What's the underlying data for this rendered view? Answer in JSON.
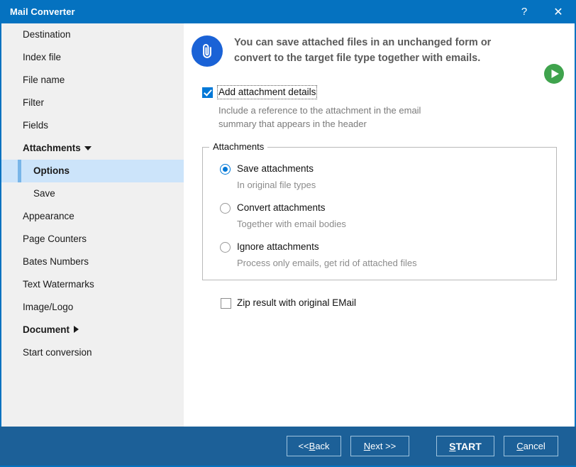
{
  "window": {
    "title": "Mail Converter",
    "help_label": "?",
    "close_label": "✕"
  },
  "sidebar": {
    "items": [
      {
        "label": "Destination",
        "kind": "item"
      },
      {
        "label": "Index file",
        "kind": "item"
      },
      {
        "label": "File name",
        "kind": "item"
      },
      {
        "label": "Filter",
        "kind": "item"
      },
      {
        "label": "Fields",
        "kind": "item"
      },
      {
        "label": "Attachments",
        "kind": "group-expanded"
      },
      {
        "label": "Options",
        "kind": "sub-active"
      },
      {
        "label": "Save",
        "kind": "sub"
      },
      {
        "label": "Appearance",
        "kind": "item"
      },
      {
        "label": "Page Counters",
        "kind": "item"
      },
      {
        "label": "Bates Numbers",
        "kind": "item"
      },
      {
        "label": "Text Watermarks",
        "kind": "item"
      },
      {
        "label": "Image/Logo",
        "kind": "item"
      },
      {
        "label": "Document",
        "kind": "group-collapsed"
      },
      {
        "label": "Start conversion",
        "kind": "item"
      }
    ]
  },
  "banner": {
    "line1": "You can save attached files in an unchanged form or",
    "line2": "convert to the target file type together with emails.",
    "icon": "paperclip-icon",
    "play_icon": "play-icon"
  },
  "options": {
    "add_details": {
      "label": "Add attachment details",
      "checked": true,
      "help_line1": "Include a reference to the attachment in the email",
      "help_line2": "summary that appears in the header"
    },
    "group_title": "Attachments",
    "radios": [
      {
        "label": "Save attachments",
        "sub": "In original file types",
        "selected": true
      },
      {
        "label": "Convert attachments",
        "sub": "Together with email bodies",
        "selected": false
      },
      {
        "label": "Ignore attachments",
        "sub": "Process only emails, get rid of attached files",
        "selected": false
      }
    ],
    "zip": {
      "label": "Zip result with original EMail",
      "checked": false
    }
  },
  "footer": {
    "back": {
      "pre": "<< ",
      "accel": "B",
      "post": "ack"
    },
    "next": {
      "pre": "",
      "accel": "N",
      "post": "ext >>"
    },
    "start": {
      "pre": "",
      "accel": "S",
      "post": "TART"
    },
    "cancel": {
      "pre": "",
      "accel": "C",
      "post": "ancel"
    }
  },
  "colors": {
    "title_blue": "#0572c0",
    "footer_blue": "#1c6098",
    "sidebar_bg": "#f0f0f0",
    "active_row": "#cce4fa",
    "accent_bar": "#78b5e8",
    "clip_blue": "#1a62d6",
    "play_green": "#3fa34d",
    "checkbox_blue": "#0078d7"
  }
}
